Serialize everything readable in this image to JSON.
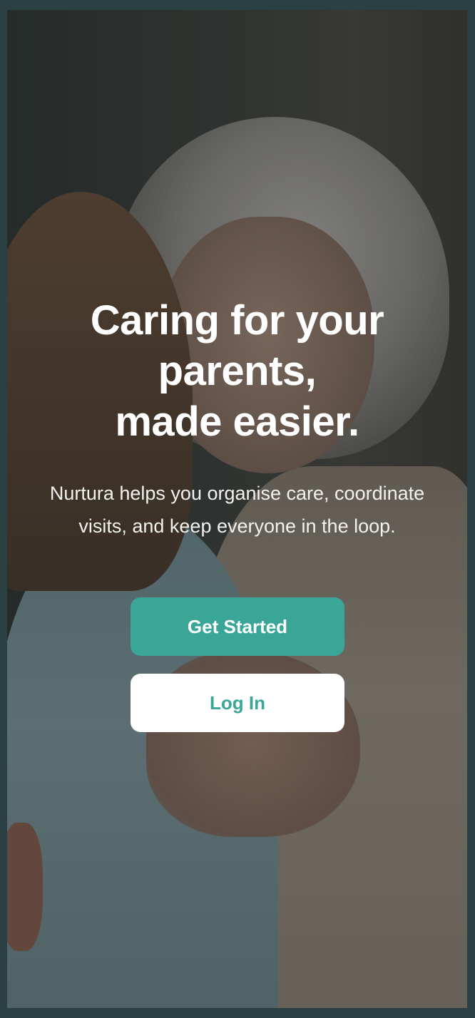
{
  "welcome": {
    "headline_lines": [
      "Caring for your",
      "parents,",
      "made easier."
    ],
    "subtitle": "Nurtura helps you organise care, coordinate visits, and keep everyone in the loop.",
    "primary_button": "Get Started",
    "secondary_button": "Log In"
  },
  "theme": {
    "accent": "#3aa698",
    "frame_border": "#2a4042",
    "text_on_image": "#ffffff"
  },
  "background_image": {
    "subject": "elderly woman embracing a younger woman"
  }
}
